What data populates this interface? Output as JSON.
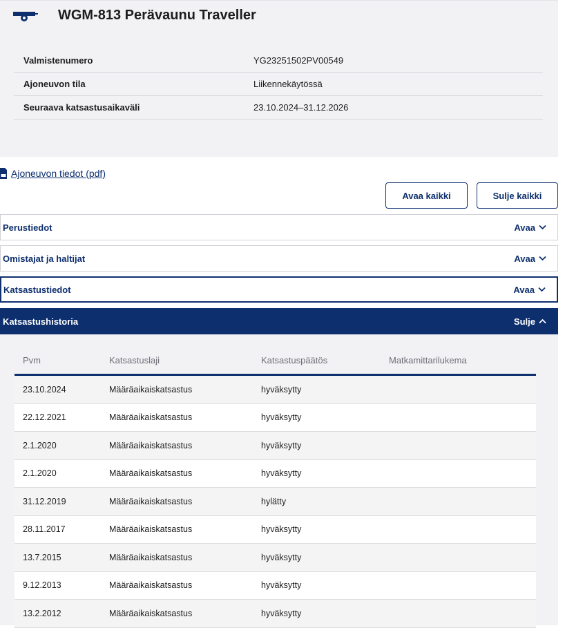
{
  "vehicle": {
    "title": "WGM-813 Perävaunu Traveller",
    "icon": "trailer-icon"
  },
  "summary": {
    "rows": [
      {
        "label": "Valmistenumero",
        "value": "YG23251502PV00549"
      },
      {
        "label": "Ajoneuvon tila",
        "value": "Liikennekäytössä"
      },
      {
        "label": "Seuraava katsastusaikaväli",
        "value": "23.10.2024–31.12.2026"
      }
    ]
  },
  "pdf_link": {
    "label": "Ajoneuvon tiedot (pdf)",
    "icon": "pdf-file-icon"
  },
  "controls": {
    "open_all": "Avaa kaikki",
    "close_all": "Sulje kaikki"
  },
  "accordion": {
    "sections": [
      {
        "label": "Perustiedot",
        "toggle": "Avaa"
      },
      {
        "label": "Omistajat ja haltijat",
        "toggle": "Avaa"
      },
      {
        "label": "Katsastustiedot",
        "toggle": "Avaa"
      },
      {
        "label": "Katsastushistoria",
        "toggle": "Sulje"
      }
    ]
  },
  "history": {
    "headers": {
      "date": "Pvm",
      "type": "Katsastuslaji",
      "decision": "Katsastuspäätös",
      "odometer": "Matkamittarilukema"
    },
    "rows": [
      {
        "date": "23.10.2024",
        "type": "Määräaikaiskatsastus",
        "decision": "hyväksytty",
        "odometer": ""
      },
      {
        "date": "22.12.2021",
        "type": "Määräaikaiskatsastus",
        "decision": "hyväksytty",
        "odometer": ""
      },
      {
        "date": "2.1.2020",
        "type": "Määräaikaiskatsastus",
        "decision": "hyväksytty",
        "odometer": ""
      },
      {
        "date": "2.1.2020",
        "type": "Määräaikaiskatsastus",
        "decision": "hyväksytty",
        "odometer": ""
      },
      {
        "date": "31.12.2019",
        "type": "Määräaikaiskatsastus",
        "decision": "hylätty",
        "odometer": ""
      },
      {
        "date": "28.11.2017",
        "type": "Määräaikaiskatsastus",
        "decision": "hyväksytty",
        "odometer": ""
      },
      {
        "date": "13.7.2015",
        "type": "Määräaikaiskatsastus",
        "decision": "hyväksytty",
        "odometer": ""
      },
      {
        "date": "9.12.2013",
        "type": "Määräaikaiskatsastus",
        "decision": "hyväksytty",
        "odometer": ""
      },
      {
        "date": "13.2.2012",
        "type": "Määräaikaiskatsastus",
        "decision": "hyväksytty",
        "odometer": ""
      }
    ]
  },
  "colors": {
    "brand_navy": "#0d2f6e",
    "panel_gray": "#f2f2f4"
  }
}
